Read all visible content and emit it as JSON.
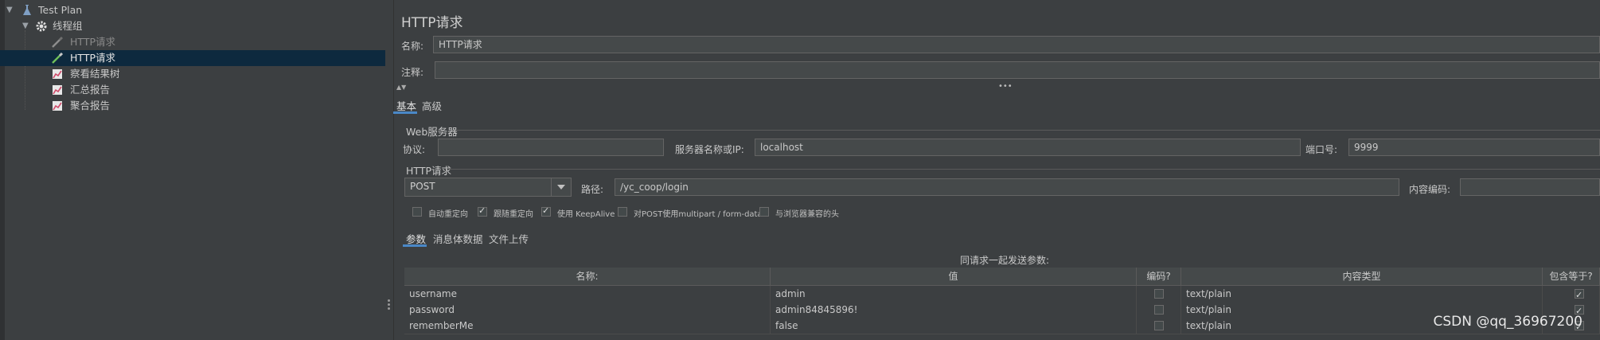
{
  "tree": {
    "items": [
      {
        "label": "Test Plan",
        "icon": "test-plan-icon",
        "expanded": true
      },
      {
        "label": "线程组",
        "icon": "gear-icon",
        "expanded": true
      },
      {
        "label": "HTTP请求",
        "icon": "pipette-icon",
        "disabled": true
      },
      {
        "label": "HTTP请求",
        "icon": "pipette-icon",
        "selected": true
      },
      {
        "label": "察看结果树",
        "icon": "chart-icon"
      },
      {
        "label": "汇总报告",
        "icon": "chart-icon"
      },
      {
        "label": "聚合报告",
        "icon": "chart-icon"
      }
    ]
  },
  "panel": {
    "title": "HTTP请求",
    "name_label": "名称:",
    "name_value": "HTTP请求",
    "comment_label": "注释:",
    "comment_value": ""
  },
  "tabs": {
    "basic": "基本",
    "advanced": "高级"
  },
  "web_server": {
    "section": "Web服务器",
    "protocol_label": "协议:",
    "protocol_value": "",
    "server_label": "服务器名称或IP:",
    "server_value": "localhost",
    "port_label": "端口号:",
    "port_value": "9999"
  },
  "http_request": {
    "section": "HTTP请求",
    "method": "POST",
    "path_label": "路径:",
    "path_value": "/yc_coop/login",
    "encoding_label": "内容编码:",
    "encoding_value": ""
  },
  "options": [
    {
      "label": "自动重定向",
      "checked": false
    },
    {
      "label": "跟随重定向",
      "checked": true
    },
    {
      "label": "使用 KeepAlive",
      "checked": true
    },
    {
      "label": "对POST使用multipart / form-data",
      "checked": false
    },
    {
      "label": "与浏览器兼容的头",
      "checked": false
    }
  ],
  "sub_tabs": {
    "params": "参数",
    "body": "消息体数据",
    "files": "文件上传"
  },
  "params_caption": "同请求一起发送参数:",
  "table": {
    "headers": [
      "名称:",
      "值",
      "编码?",
      "内容类型",
      "包含等于?"
    ],
    "rows": [
      {
        "name": "username",
        "value": "admin",
        "encode": false,
        "type": "text/plain",
        "include_equals": true
      },
      {
        "name": "password",
        "value": "admin84845896!",
        "encode": false,
        "type": "text/plain",
        "include_equals": true
      },
      {
        "name": "rememberMe",
        "value": "false",
        "encode": false,
        "type": "text/plain",
        "include_equals": true
      }
    ]
  },
  "watermark": "CSDN @qq_36967200",
  "colors": {
    "background": "#3c3f41",
    "selection": "#0d293e",
    "accent": "#4a88c7"
  }
}
